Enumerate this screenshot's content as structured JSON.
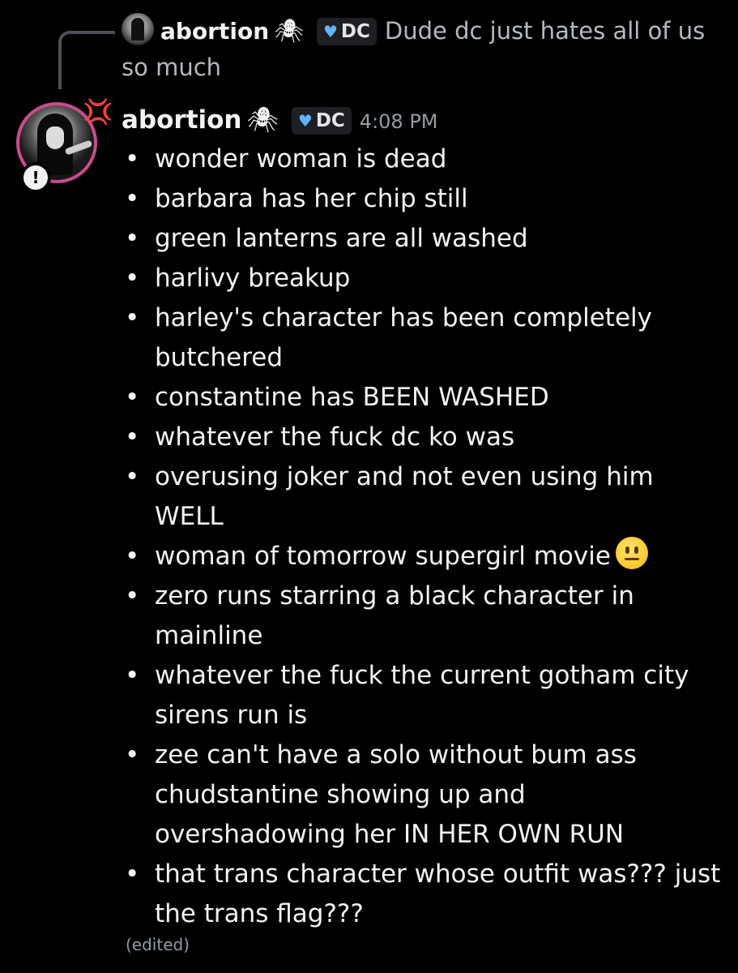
{
  "reply": {
    "author": "abortion",
    "author_icon": "spider-icon",
    "tag_icon": "blue-heart-icon",
    "tag": "DC",
    "text": "Dude dc just hates all of us so much"
  },
  "message": {
    "author": "abortion",
    "author_icon": "spider-icon",
    "tag_icon": "blue-heart-icon",
    "tag": "DC",
    "time": "4:08 PM",
    "avatar_decoration": "anger-symbol",
    "status_icon": "exclamation-icon",
    "items": [
      "wonder woman is dead",
      "barbara has her chip still",
      "green lanterns are all washed",
      "harlivy breakup",
      "harley's character has been completely butchered",
      "constantine has BEEN WASHED",
      "whatever the fuck dc ko was",
      "overusing joker and not even using him WELL",
      "woman of tomorrow supergirl movie",
      "zero runs starring a black character in mainline",
      "whatever the fuck the current gotham city sirens run is",
      "zee can't have a solo without bum ass chudstantine showing up and overshadowing her IN HER OWN RUN",
      "that trans character whose outfit was??? just the trans flag???"
    ],
    "item_9_emoji": "neutral-face-emoji",
    "edited": "(edited)"
  },
  "colors": {
    "background": "#000000",
    "text": "#f2f3f5",
    "muted": "#949ba4",
    "avatar_ring": "#c94c8e",
    "tag_bg": "#1e1f22",
    "heart": "#5fb3ff"
  }
}
